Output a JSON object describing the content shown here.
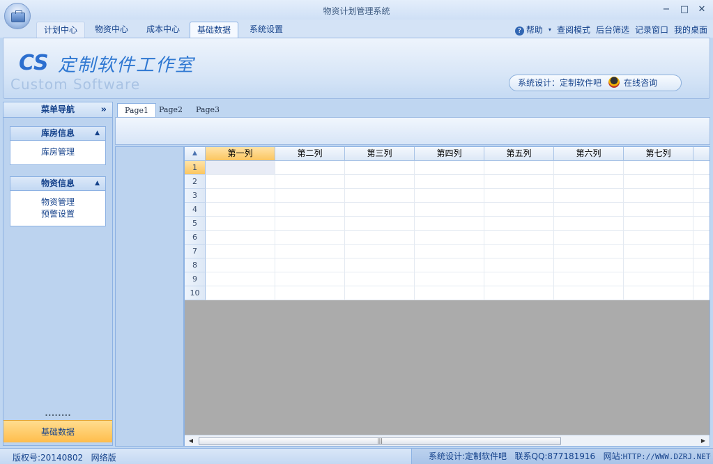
{
  "window": {
    "title": "物资计划管理系统",
    "minimize": "−",
    "maximize": "□",
    "close": "✕"
  },
  "ribbon": {
    "tabs": [
      "计划中心",
      "物资中心",
      "成本中心",
      "基础数据",
      "系统设置"
    ],
    "active_tab": "基础数据",
    "quick_links": {
      "help": "帮助",
      "view_mode": "查阅模式",
      "bg_filter": "后台筛选",
      "log_window": "记录窗口",
      "my_desktop": "我的桌面"
    }
  },
  "banner": {
    "logo_cs": "CS",
    "logo_cn": "定制软件工作室",
    "logo_en": "Custom Software",
    "design_label": "系统设计：",
    "design_value": "定制软件吧",
    "consult": "在线咨询"
  },
  "nav": {
    "header": "菜单导航",
    "collapse_glyph": "»",
    "groups": [
      {
        "title": "库房信息",
        "items": [
          "库房管理"
        ]
      },
      {
        "title": "物资信息",
        "items": [
          "物资管理",
          "预警设置"
        ]
      }
    ],
    "grip": "••••••••",
    "active_item": "基础数据"
  },
  "pages": {
    "tabs": [
      "Page1",
      "Page2",
      "Page3"
    ],
    "active": "Page1"
  },
  "grid": {
    "corner_glyph": "▲",
    "columns": [
      "第一列",
      "第二列",
      "第三列",
      "第四列",
      "第五列",
      "第六列",
      "第七列"
    ],
    "row_numbers": [
      "1",
      "2",
      "3",
      "4",
      "5",
      "6",
      "7",
      "8",
      "9",
      "10"
    ],
    "selected_row": "1",
    "selected_column": "第一列",
    "scroll_grip": "|||"
  },
  "status": {
    "copyright": "版权号:20140802",
    "edition": "网络版",
    "designer": "系统设计:定制软件吧",
    "qq": "联系QQ:877181916",
    "site_label": "网站:",
    "site_value": "HTTP://WWW.DZRJ.NET"
  },
  "colors": {
    "accent_orange": "#ffbd4c",
    "ribbon_blue": "#bfd6f1",
    "text_blue": "#15428b"
  }
}
